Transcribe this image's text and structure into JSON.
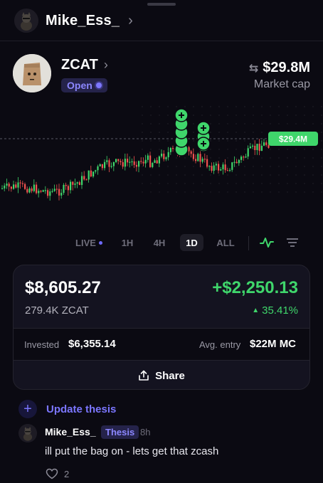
{
  "header": {
    "user_name": "Mike_Ess_",
    "chevron": "›"
  },
  "token": {
    "name": "ZCAT",
    "chevron": "›",
    "status": "Open",
    "market_cap_value": "$29.8M",
    "market_cap_label": "Market cap",
    "swap_icon": "swap-arrows-icon"
  },
  "chart_data": {
    "type": "candlestick",
    "current_price_label": "$29.4M",
    "price_level": 29.4,
    "buy_marker_groups": [
      {
        "count": 3,
        "position": "upper"
      },
      {
        "count": 2,
        "position": "lower"
      }
    ],
    "colors": {
      "up": "#3fd66b",
      "down": "#f0524f",
      "marker": "#3fd66b",
      "price_line": "#5a5966"
    }
  },
  "timeframes": {
    "options": [
      "LIVE",
      "1H",
      "4H",
      "1D",
      "ALL"
    ],
    "selected": "1D",
    "chart_icon": "line-chart-icon",
    "filter_icon": "filter-lines-icon"
  },
  "position": {
    "value": "$8,605.27",
    "pnl": "+$2,250.13",
    "amount": "279.4K ZCAT",
    "pnl_percent": "35.41%",
    "invested_label": "Invested",
    "invested_value": "$6,355.14",
    "avg_entry_label": "Avg. entry",
    "avg_entry_value": "$22M MC",
    "share_label": "Share"
  },
  "thesis": {
    "update_label": "Update thesis"
  },
  "comment": {
    "user": "Mike_Ess_",
    "badge": "Thesis",
    "time": "8h",
    "text": "ill put the bag on - lets get that zcash",
    "likes": "2"
  },
  "colors": {
    "background": "#0b0a12",
    "card": "#141320",
    "accent": "#7b76ff",
    "positive": "#3fd66b",
    "negative": "#f0524f"
  }
}
